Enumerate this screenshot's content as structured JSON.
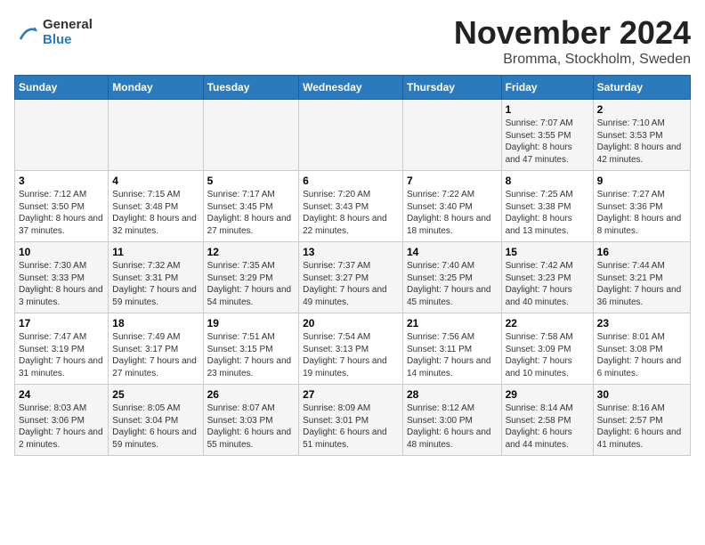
{
  "logo": {
    "line1": "General",
    "line2": "Blue"
  },
  "title": "November 2024",
  "subtitle": "Bromma, Stockholm, Sweden",
  "weekdays": [
    "Sunday",
    "Monday",
    "Tuesday",
    "Wednesday",
    "Thursday",
    "Friday",
    "Saturday"
  ],
  "weeks": [
    [
      {
        "day": "",
        "info": ""
      },
      {
        "day": "",
        "info": ""
      },
      {
        "day": "",
        "info": ""
      },
      {
        "day": "",
        "info": ""
      },
      {
        "day": "",
        "info": ""
      },
      {
        "day": "1",
        "info": "Sunrise: 7:07 AM\nSunset: 3:55 PM\nDaylight: 8 hours and 47 minutes."
      },
      {
        "day": "2",
        "info": "Sunrise: 7:10 AM\nSunset: 3:53 PM\nDaylight: 8 hours and 42 minutes."
      }
    ],
    [
      {
        "day": "3",
        "info": "Sunrise: 7:12 AM\nSunset: 3:50 PM\nDaylight: 8 hours and 37 minutes."
      },
      {
        "day": "4",
        "info": "Sunrise: 7:15 AM\nSunset: 3:48 PM\nDaylight: 8 hours and 32 minutes."
      },
      {
        "day": "5",
        "info": "Sunrise: 7:17 AM\nSunset: 3:45 PM\nDaylight: 8 hours and 27 minutes."
      },
      {
        "day": "6",
        "info": "Sunrise: 7:20 AM\nSunset: 3:43 PM\nDaylight: 8 hours and 22 minutes."
      },
      {
        "day": "7",
        "info": "Sunrise: 7:22 AM\nSunset: 3:40 PM\nDaylight: 8 hours and 18 minutes."
      },
      {
        "day": "8",
        "info": "Sunrise: 7:25 AM\nSunset: 3:38 PM\nDaylight: 8 hours and 13 minutes."
      },
      {
        "day": "9",
        "info": "Sunrise: 7:27 AM\nSunset: 3:36 PM\nDaylight: 8 hours and 8 minutes."
      }
    ],
    [
      {
        "day": "10",
        "info": "Sunrise: 7:30 AM\nSunset: 3:33 PM\nDaylight: 8 hours and 3 minutes."
      },
      {
        "day": "11",
        "info": "Sunrise: 7:32 AM\nSunset: 3:31 PM\nDaylight: 7 hours and 59 minutes."
      },
      {
        "day": "12",
        "info": "Sunrise: 7:35 AM\nSunset: 3:29 PM\nDaylight: 7 hours and 54 minutes."
      },
      {
        "day": "13",
        "info": "Sunrise: 7:37 AM\nSunset: 3:27 PM\nDaylight: 7 hours and 49 minutes."
      },
      {
        "day": "14",
        "info": "Sunrise: 7:40 AM\nSunset: 3:25 PM\nDaylight: 7 hours and 45 minutes."
      },
      {
        "day": "15",
        "info": "Sunrise: 7:42 AM\nSunset: 3:23 PM\nDaylight: 7 hours and 40 minutes."
      },
      {
        "day": "16",
        "info": "Sunrise: 7:44 AM\nSunset: 3:21 PM\nDaylight: 7 hours and 36 minutes."
      }
    ],
    [
      {
        "day": "17",
        "info": "Sunrise: 7:47 AM\nSunset: 3:19 PM\nDaylight: 7 hours and 31 minutes."
      },
      {
        "day": "18",
        "info": "Sunrise: 7:49 AM\nSunset: 3:17 PM\nDaylight: 7 hours and 27 minutes."
      },
      {
        "day": "19",
        "info": "Sunrise: 7:51 AM\nSunset: 3:15 PM\nDaylight: 7 hours and 23 minutes."
      },
      {
        "day": "20",
        "info": "Sunrise: 7:54 AM\nSunset: 3:13 PM\nDaylight: 7 hours and 19 minutes."
      },
      {
        "day": "21",
        "info": "Sunrise: 7:56 AM\nSunset: 3:11 PM\nDaylight: 7 hours and 14 minutes."
      },
      {
        "day": "22",
        "info": "Sunrise: 7:58 AM\nSunset: 3:09 PM\nDaylight: 7 hours and 10 minutes."
      },
      {
        "day": "23",
        "info": "Sunrise: 8:01 AM\nSunset: 3:08 PM\nDaylight: 7 hours and 6 minutes."
      }
    ],
    [
      {
        "day": "24",
        "info": "Sunrise: 8:03 AM\nSunset: 3:06 PM\nDaylight: 7 hours and 2 minutes."
      },
      {
        "day": "25",
        "info": "Sunrise: 8:05 AM\nSunset: 3:04 PM\nDaylight: 6 hours and 59 minutes."
      },
      {
        "day": "26",
        "info": "Sunrise: 8:07 AM\nSunset: 3:03 PM\nDaylight: 6 hours and 55 minutes."
      },
      {
        "day": "27",
        "info": "Sunrise: 8:09 AM\nSunset: 3:01 PM\nDaylight: 6 hours and 51 minutes."
      },
      {
        "day": "28",
        "info": "Sunrise: 8:12 AM\nSunset: 3:00 PM\nDaylight: 6 hours and 48 minutes."
      },
      {
        "day": "29",
        "info": "Sunrise: 8:14 AM\nSunset: 2:58 PM\nDaylight: 6 hours and 44 minutes."
      },
      {
        "day": "30",
        "info": "Sunrise: 8:16 AM\nSunset: 2:57 PM\nDaylight: 6 hours and 41 minutes."
      }
    ]
  ]
}
